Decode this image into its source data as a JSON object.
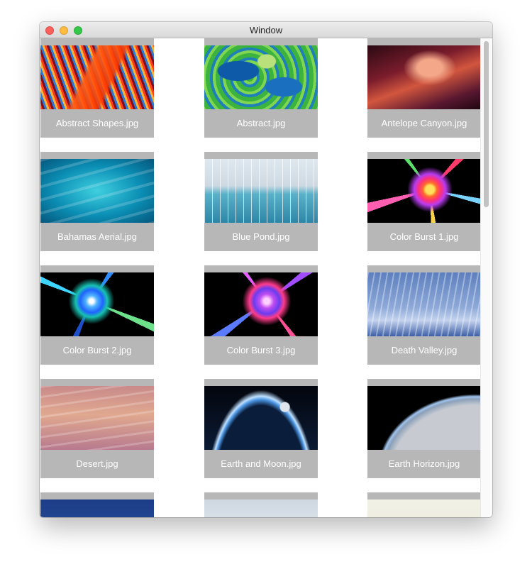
{
  "window": {
    "title": "Window"
  },
  "images": [
    {
      "label": "Abstract Shapes.jpg",
      "art": "img-abstract-shapes"
    },
    {
      "label": "Abstract.jpg",
      "art": "img-abstract"
    },
    {
      "label": "Antelope Canyon.jpg",
      "art": "img-antelope"
    },
    {
      "label": "Bahamas Aerial.jpg",
      "art": "img-bahamas"
    },
    {
      "label": "Blue Pond.jpg",
      "art": "img-bluepond"
    },
    {
      "label": "Color Burst 1.jpg",
      "art": "img-colorburst1"
    },
    {
      "label": "Color Burst 2.jpg",
      "art": "img-colorburst2"
    },
    {
      "label": "Color Burst 3.jpg",
      "art": "img-colorburst3"
    },
    {
      "label": "Death Valley.jpg",
      "art": "img-deathvalley"
    },
    {
      "label": "Desert.jpg",
      "art": "img-desert"
    },
    {
      "label": "Earth and Moon.jpg",
      "art": "img-earthmoon"
    },
    {
      "label": "Earth Horizon.jpg",
      "art": "img-earthhorizon"
    },
    {
      "label": "",
      "art": "img-row5a"
    },
    {
      "label": "",
      "art": "img-row5b"
    },
    {
      "label": "",
      "art": "img-row5c"
    }
  ]
}
